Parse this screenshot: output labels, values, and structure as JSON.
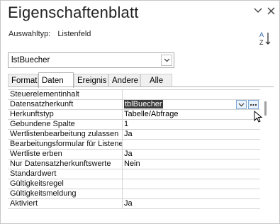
{
  "window": {
    "title": "Eigenschaftenblatt"
  },
  "selection": {
    "label": "Auswahltyp:",
    "value": "Listenfeld"
  },
  "object_combo": {
    "value": "lstBuecher"
  },
  "tabs": [
    {
      "label": "Format"
    },
    {
      "label": "Daten"
    },
    {
      "label": "Ereignis"
    },
    {
      "label": "Andere"
    },
    {
      "label": "Alle"
    }
  ],
  "active_tab": "Daten",
  "properties": [
    {
      "name": "Steuerelementinhalt",
      "value": ""
    },
    {
      "name": "Datensatzherkunft",
      "value": "tblBuecher"
    },
    {
      "name": "Herkunftstyp",
      "value": "Tabelle/Abfrage"
    },
    {
      "name": "Gebundene Spalte",
      "value": "1"
    },
    {
      "name": "Wertlistenbearbeitung zulassen",
      "value": "Ja"
    },
    {
      "name": "Bearbeitungsformular für Listenelemente",
      "value": ""
    },
    {
      "name": "Wertliste erben",
      "value": "Ja"
    },
    {
      "name": "Nur Datensatzherkunftswerte",
      "value": "Nein"
    },
    {
      "name": "Standardwert",
      "value": ""
    },
    {
      "name": "Gültigkeitsregel",
      "value": ""
    },
    {
      "name": "Gültigkeitsmeldung",
      "value": ""
    },
    {
      "name": "Aktiviert",
      "value": "Ja"
    }
  ],
  "icons": {
    "sort": "sort-az-icon",
    "collapse": "chevron-down-icon",
    "close": "close-icon",
    "dropdown": "chevron-down-icon",
    "builder": "ellipsis-icon"
  },
  "colors": {
    "selection_highlight": "#3b3b3b",
    "cell_button_border": "#7aa7d8",
    "grid_line": "#d4d4d4"
  }
}
